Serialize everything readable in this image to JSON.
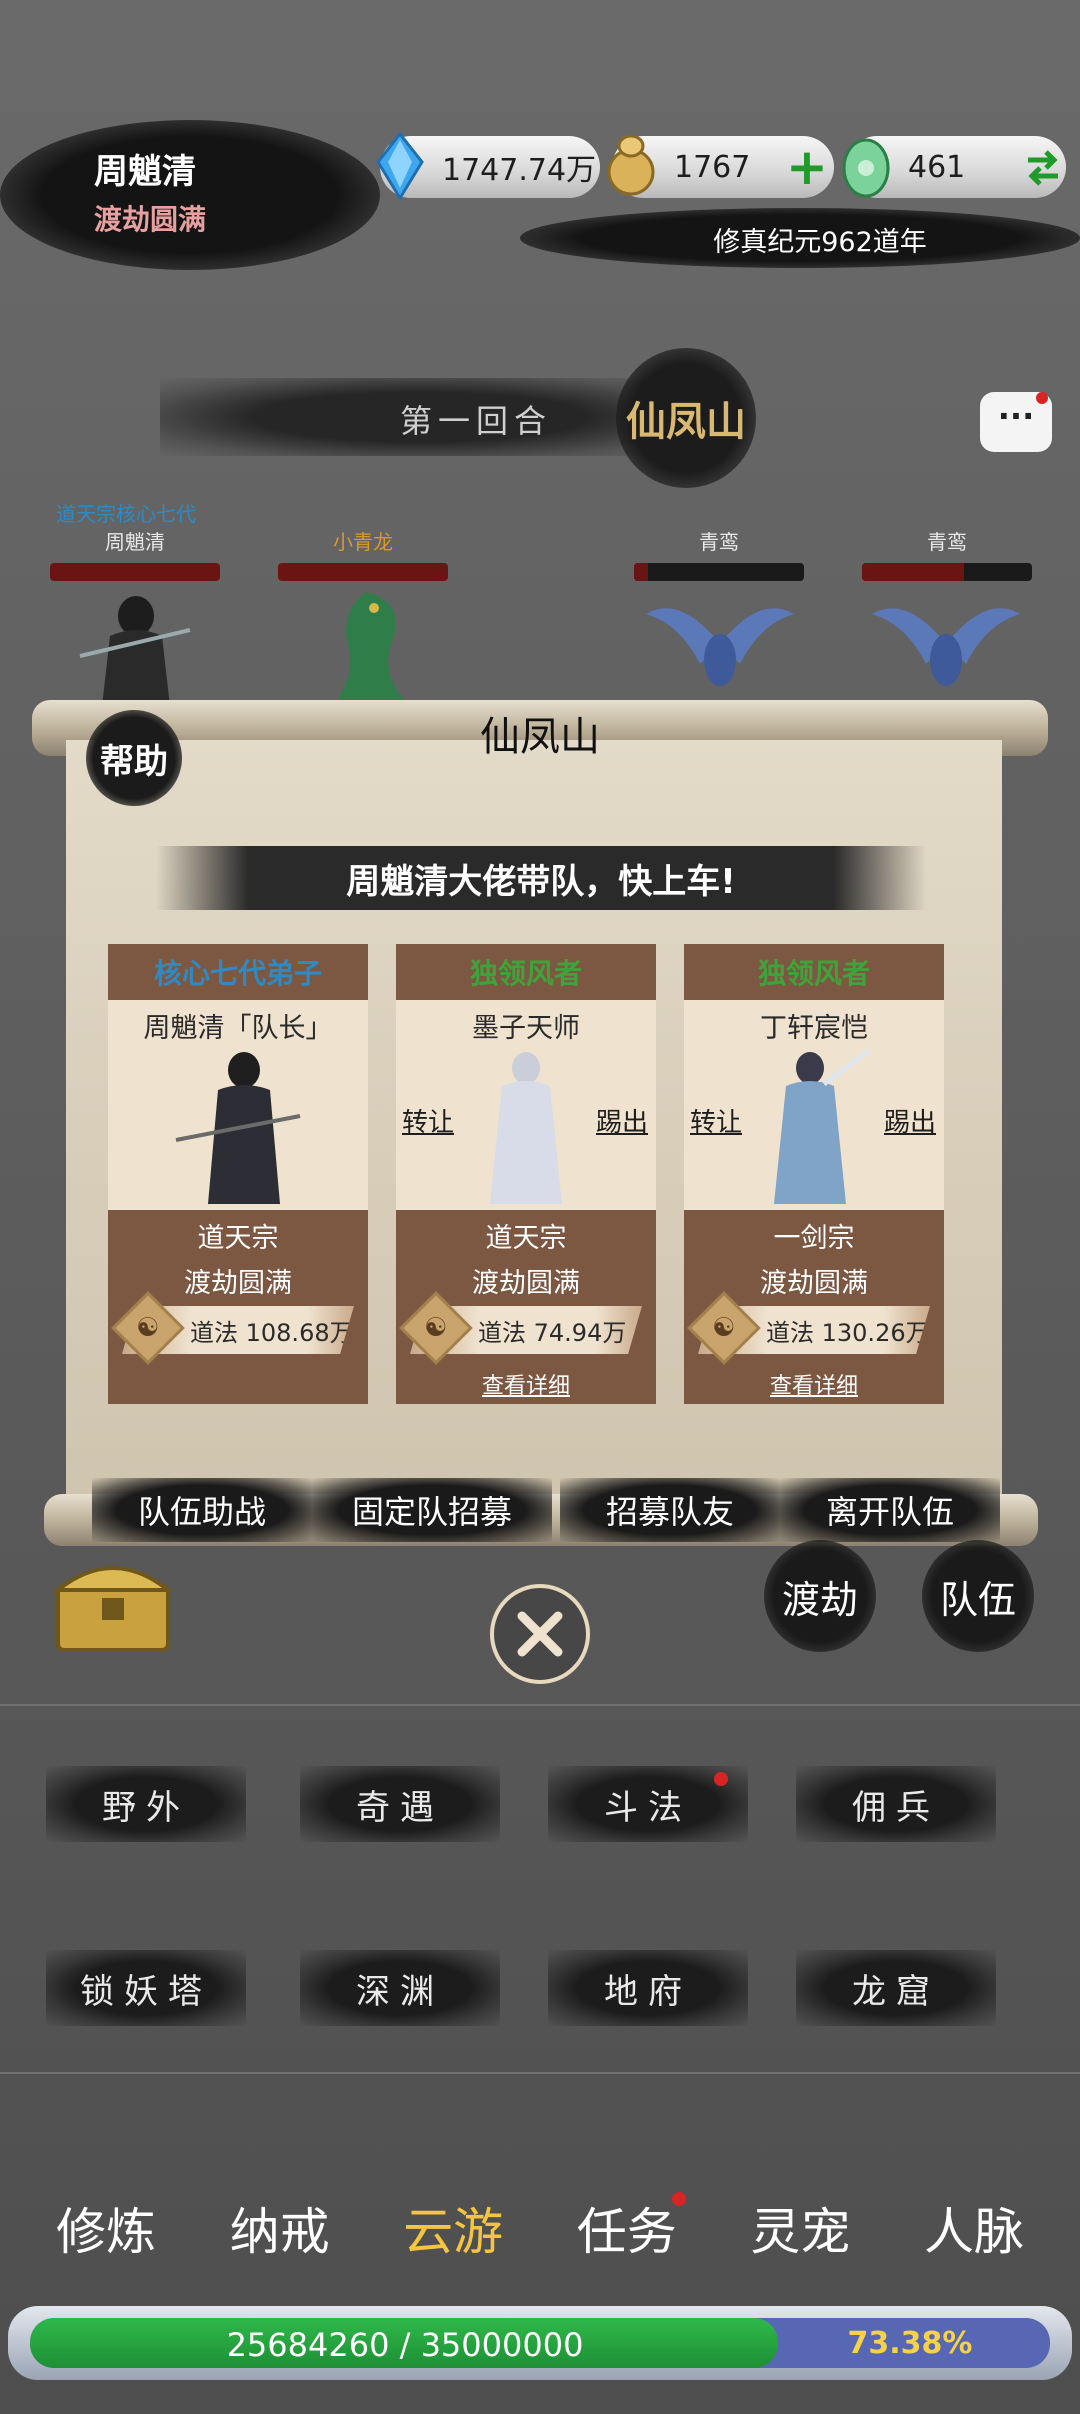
{
  "player": {
    "name": "周魈清",
    "rank": "渡劫圆满"
  },
  "resources": {
    "spirit_stone": {
      "value": "1747.74万",
      "icon": "blue-crystal-icon"
    },
    "gold": {
      "value": "1767",
      "icon": "gold-ingot-icon",
      "action_icon": "plus-icon"
    },
    "jade": {
      "value": "461",
      "icon": "jade-icon",
      "action_icon": "swap-arrows-icon"
    }
  },
  "era": "修真纪元962道年",
  "battle": {
    "round": "第一回合",
    "location": "仙凤山",
    "sect_title": "道天宗核心七代",
    "units": [
      {
        "name": "周魈清",
        "name_color": "#e8e8e8",
        "hp": 1.0
      },
      {
        "name": "小青龙",
        "name_color": "#d79a2a",
        "hp": 1.0
      },
      {
        "name": "青鸾",
        "name_color": "#e8e8e8",
        "hp": 0.08
      },
      {
        "name": "青鸾",
        "name_color": "#e8e8e8",
        "hp": 0.6
      }
    ]
  },
  "panel": {
    "title": "仙凤山",
    "help": "帮助",
    "slogan": "周魈清大佬带队，快上车!",
    "members": [
      {
        "role": "核心七代弟子",
        "role_color": "#2f8ac4",
        "name": "周魈清「队长」",
        "sect": "道天宗",
        "realm": "渡劫圆满",
        "daofa": "道法 108.68万",
        "transfer": "",
        "kick": "",
        "detail": ""
      },
      {
        "role": "独领风者",
        "role_color": "#3fa33a",
        "name": "墨子天师",
        "sect": "道天宗",
        "realm": "渡劫圆满",
        "daofa": "道法 74.94万",
        "transfer": "转让",
        "kick": "踢出",
        "detail": "查看详细"
      },
      {
        "role": "独领风者",
        "role_color": "#3fa33a",
        "name": "丁轩宸恺",
        "sect": "一剑宗",
        "realm": "渡劫圆满",
        "daofa": "道法 130.26万",
        "transfer": "转让",
        "kick": "踢出",
        "detail": "查看详细"
      }
    ],
    "taiji": "☯",
    "actions": [
      "队伍助战",
      "固定队招募",
      "招募队友",
      "离开队伍"
    ]
  },
  "side_buttons": {
    "tribulation": "渡劫",
    "team": "队伍"
  },
  "map_buttons": [
    "野外",
    "奇遇",
    "斗法",
    "佣兵",
    "锁妖塔",
    "深渊",
    "地府",
    "龙窟"
  ],
  "nav": {
    "items": [
      "修炼",
      "纳戒",
      "云游",
      "任务",
      "灵宠",
      "人脉"
    ],
    "active": "云游"
  },
  "exp": {
    "text": "25684260 / 35000000",
    "percent": "73.38%",
    "fraction": 0.7338
  },
  "colors": {
    "accent_gold": "#f5c542",
    "card_brown": "#7c5843",
    "alert_red": "#d82424"
  }
}
